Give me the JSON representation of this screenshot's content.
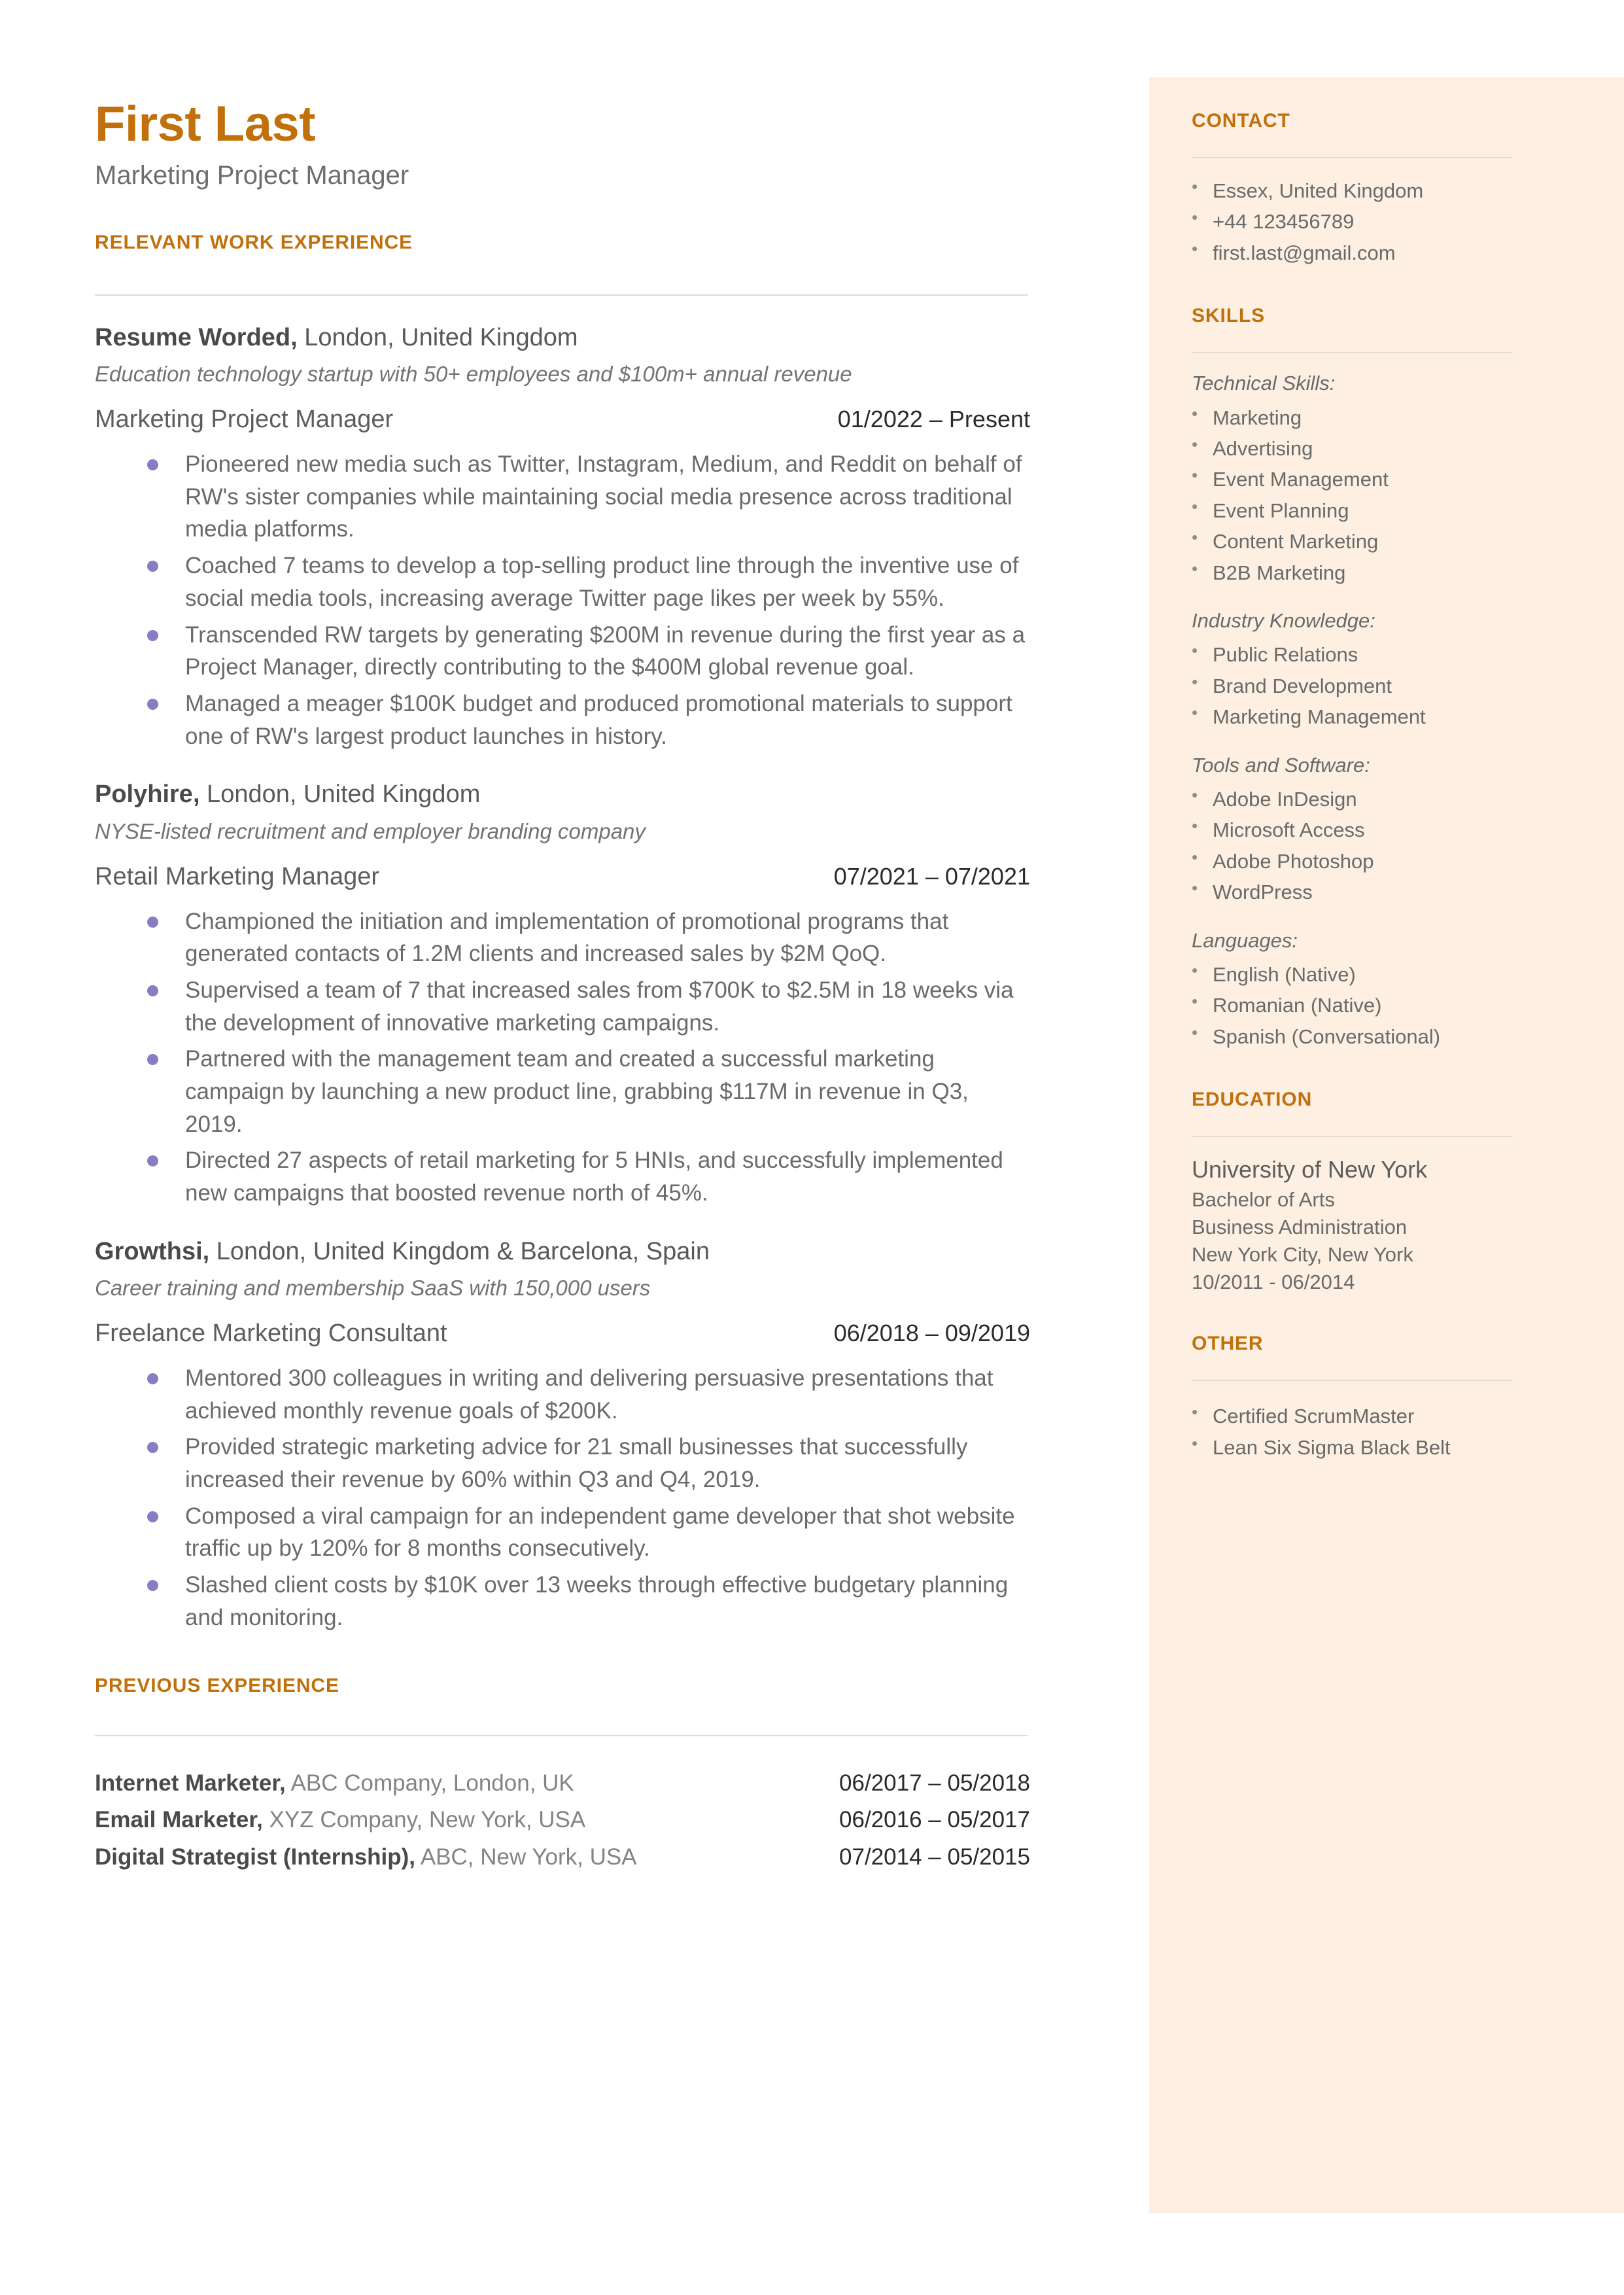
{
  "colors": {
    "accent": "#c2700c",
    "sidebar_bg": "#fdf0e2",
    "body_text": "#6a6a6a",
    "bullet": "#8a7cc4",
    "rule": "#dcdcdc"
  },
  "header": {
    "name": "First Last",
    "headline": "Marketing Project Manager"
  },
  "work": {
    "section_title": "RELEVANT WORK EXPERIENCE",
    "jobs": [
      {
        "company": "Resume Worded,",
        "location": " London, United Kingdom",
        "description": "Education technology startup with 50+ employees and $100m+ annual revenue",
        "role": "Marketing Project Manager",
        "dates": "01/2022 – Present",
        "bullets": [
          "Pioneered new media such as Twitter, Instagram, Medium, and Reddit on behalf of RW's sister companies while maintaining social media presence across traditional media platforms.",
          "Coached 7 teams to develop a top-selling product line through the inventive use of social media tools, increasing average Twitter page likes per week by 55%.",
          "Transcended RW targets by generating $200M in revenue during the first year as a Project Manager, directly contributing to the $400M global revenue goal.",
          "Managed a meager $100K budget and produced promotional materials to support one of RW's largest product launches in history."
        ]
      },
      {
        "company": "Polyhire,",
        "location": " London, United Kingdom",
        "description": "NYSE-listed recruitment and employer branding company",
        "role": "Retail Marketing Manager",
        "dates": "07/2021 – 07/2021",
        "bullets": [
          "Championed the initiation and implementation of promotional programs that generated contacts of 1.2M clients and increased sales by $2M QoQ.",
          "Supervised a team of 7 that increased sales from $700K to $2.5M in 18 weeks via the development of innovative marketing campaigns.",
          "Partnered with the management team and created a successful marketing campaign by launching a new product line, grabbing $117M in revenue in Q3, 2019.",
          "Directed 27 aspects of retail marketing for 5 HNIs, and successfully implemented new campaigns that boosted revenue north of 45%."
        ]
      },
      {
        "company": "Growthsi,",
        "location": " London, United Kingdom & Barcelona, Spain",
        "description": "Career training and membership SaaS with 150,000 users",
        "role": "Freelance Marketing Consultant",
        "dates": "06/2018 – 09/2019",
        "bullets": [
          "Mentored 300 colleagues in writing and delivering persuasive presentations that achieved monthly revenue goals of $200K.",
          "Provided strategic marketing advice for 21 small businesses that successfully increased their revenue by 60% within Q3 and Q4, 2019.",
          "Composed a viral campaign for an independent game developer that shot website traffic up by 120% for 8 months consecutively.",
          "Slashed client costs by $10K over 13 weeks through effective budgetary planning and monitoring."
        ]
      }
    ]
  },
  "previous": {
    "section_title": "PREVIOUS EXPERIENCE",
    "rows": [
      {
        "role": "Internet Marketer,",
        "detail": " ABC Company, London, UK",
        "dates": "06/2017 – 05/2018"
      },
      {
        "role": "Email Marketer,",
        "detail": " XYZ Company, New York, USA",
        "dates": "06/2016 – 05/2017"
      },
      {
        "role": "Digital Strategist (Internship),",
        "detail": " ABC, New York, USA",
        "dates": "07/2014 – 05/2015"
      }
    ]
  },
  "sidebar": {
    "contact": {
      "title": "CONTACT",
      "items": [
        "Essex, United Kingdom",
        "+44 123456789",
        "first.last@gmail.com"
      ]
    },
    "skills": {
      "title": "SKILLS",
      "groups": [
        {
          "label": "Technical Skills:",
          "items": [
            "Marketing",
            "Advertising",
            "Event Management",
            "Event Planning",
            "Content Marketing",
            "B2B Marketing"
          ]
        },
        {
          "label": "Industry Knowledge:",
          "items": [
            "Public Relations",
            "Brand Development",
            "Marketing Management"
          ]
        },
        {
          "label": "Tools and Software:",
          "items": [
            "Adobe InDesign",
            "Microsoft Access",
            "Adobe Photoshop",
            "WordPress"
          ]
        },
        {
          "label": "Languages:",
          "items": [
            "English (Native)",
            "Romanian (Native)",
            "Spanish (Conversational)"
          ]
        }
      ]
    },
    "education": {
      "title": "EDUCATION",
      "school": "University of New York",
      "degree": "Bachelor of Arts",
      "field": "Business Administration",
      "location": "New York City, New York",
      "dates": "10/2011 - 06/2014"
    },
    "other": {
      "title": "OTHER",
      "items": [
        "Certified ScrumMaster",
        "Lean Six Sigma Black Belt"
      ]
    }
  }
}
